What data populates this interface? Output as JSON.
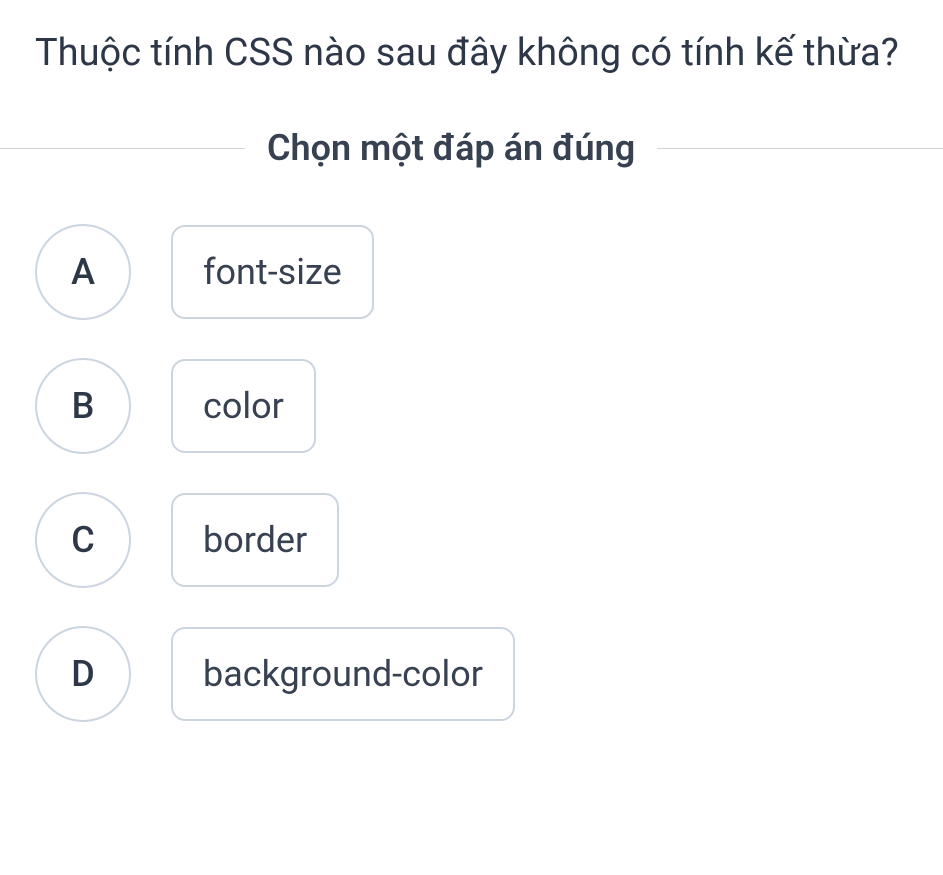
{
  "question": "Thuộc tính CSS nào sau đây không có tính kế thừa?",
  "instruction": "Chọn một đáp án đúng",
  "options": [
    {
      "letter": "A",
      "text": "font-size"
    },
    {
      "letter": "B",
      "text": "color"
    },
    {
      "letter": "C",
      "text": "border"
    },
    {
      "letter": "D",
      "text": "background-color"
    }
  ]
}
